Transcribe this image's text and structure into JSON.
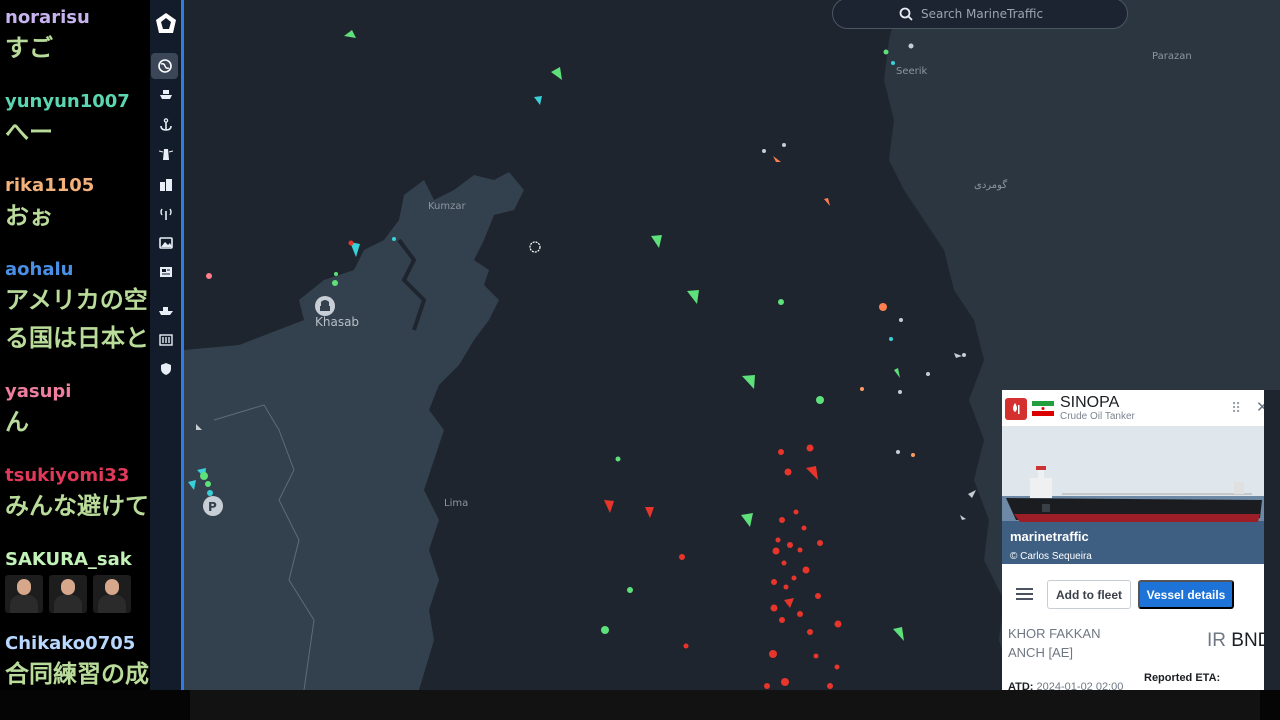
{
  "chat": {
    "messages": [
      {
        "user": "norarisu",
        "color": "#c7b3ee",
        "text": "すご"
      },
      {
        "user": "yunyun1007",
        "color": "#5bd6b0",
        "text": "へー"
      },
      {
        "user": "rika1105",
        "color": "#f4b27a",
        "text": "おぉ"
      },
      {
        "user": "aohalu",
        "color": "#4a8fe6",
        "text": "アメリカの空",
        "text2": "る国は日本と"
      },
      {
        "user": "yasupi",
        "color": "#ee7f9f",
        "text": "ん"
      },
      {
        "user": "tsukiyomi33",
        "color": "#e0395a",
        "text": "みんな避けて"
      },
      {
        "user": "SAKURA_sak",
        "color": "#c2f2b8",
        "text": ""
      },
      {
        "user": "Chikako0705",
        "color": "#b8d8ff",
        "text": "合同練習の成"
      }
    ]
  },
  "nav": {
    "items": [
      "logo",
      "map",
      "vessels",
      "ports",
      "lighthouse",
      "buildings",
      "antenna",
      "photos",
      "news",
      "fleet",
      "barcode",
      "shield"
    ]
  },
  "search": {
    "placeholder": "Search MarineTraffic"
  },
  "map": {
    "labels": {
      "kumzar": "Kumzar",
      "khasab": "Khasab",
      "lima": "Lima",
      "seerik": "Seerik",
      "parazan": "Parazan",
      "gowmordi": "گومردی"
    },
    "colors": {
      "sea": "#1e252e",
      "land": "#33404d",
      "accent": "#2f7de0"
    }
  },
  "vessel": {
    "name": "SINOPA",
    "type": "Crude Oil Tanker",
    "photo_brand": "marinetraffic",
    "photo_credit": "© Carlos Sequeira",
    "add_to_fleet": "Add to fleet",
    "vessel_details": "Vessel details",
    "destination_line1": "KHOR FAKKAN",
    "destination_line2": "ANCH [AE]",
    "port_country": "IR",
    "port_code": "BND",
    "reported_eta_label": "Reported ETA:",
    "atd_label": "ATD:",
    "atd_value": "2024-01-02 02:00"
  }
}
